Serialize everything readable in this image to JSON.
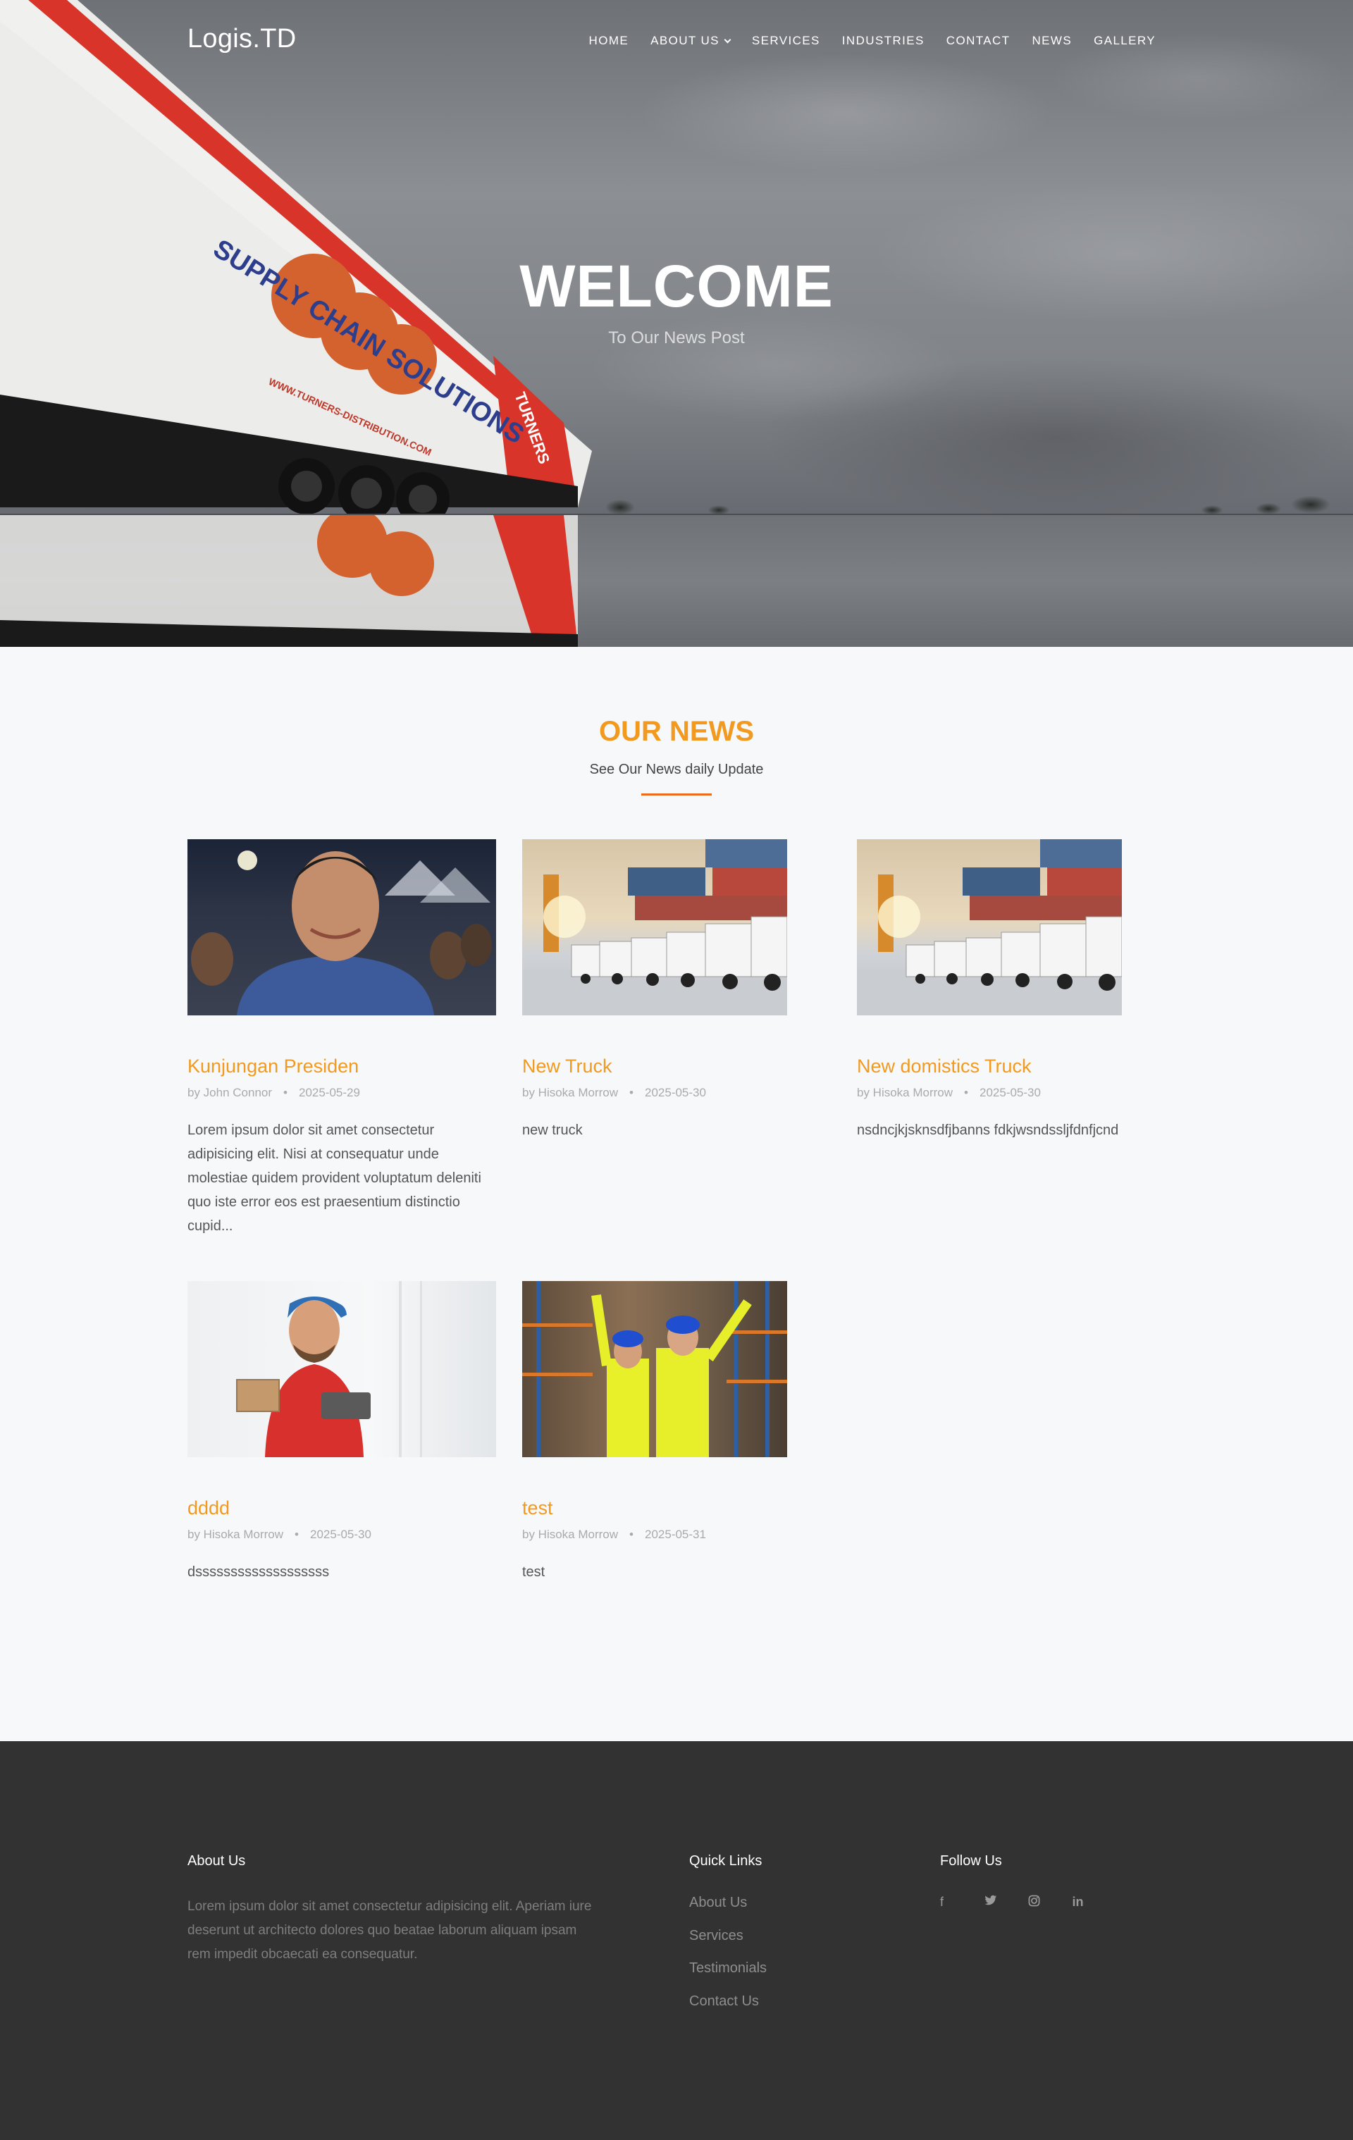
{
  "brand": {
    "logo": "Logis.TD",
    "accent": "#f29a1f",
    "underline": "#ea6a1e",
    "footer_bg": "#323232"
  },
  "nav": {
    "items": [
      {
        "label": "HOME"
      },
      {
        "label": "ABOUT US",
        "has_dropdown": true
      },
      {
        "label": "SERVICES"
      },
      {
        "label": "INDUSTRIES"
      },
      {
        "label": "CONTACT"
      },
      {
        "label": "NEWS"
      },
      {
        "label": "GALLERY"
      }
    ]
  },
  "hero": {
    "title": "WELCOME",
    "subtitle": "To Our News Post",
    "truck_text": "SUPPLY CHAIN SOLUTIONS",
    "truck_url": "WWW.TURNERS-DISTRIBUTION.COM",
    "truck_brand": "TURNERS"
  },
  "news": {
    "title": "OUR NEWS",
    "subtitle": "See Our News daily Update",
    "cards": [
      {
        "title": "Kunjungan Presiden",
        "author": "by John Connor",
        "date": "2025-05-29",
        "excerpt": "Lorem ipsum dolor sit amet consectetur adipisicing elit. Nisi at consequatur unde molestiae quidem provident voluptatum deleniti quo iste error eos est praesentium distinctio cupid...",
        "image": "president-photo"
      },
      {
        "title": "New Truck",
        "author": "by Hisoka Morrow",
        "date": "2025-05-30",
        "excerpt": "new truck",
        "image": "trucks-containers-photo"
      },
      {
        "title": "New domistics Truck",
        "author": "by Hisoka Morrow",
        "date": "2025-05-30",
        "excerpt": "nsdncjkjsknsdfjbanns fdkjwsndssljfdnfjcnd",
        "image": "trucks-containers-photo"
      },
      {
        "title": "dddd",
        "author": "by Hisoka Morrow",
        "date": "2025-05-30",
        "excerpt": "dsssssssssssssssssss",
        "image": "courier-photo"
      },
      {
        "title": "test",
        "author": "by Hisoka Morrow",
        "date": "2025-05-31",
        "excerpt": "test",
        "image": "warehouse-workers-photo"
      }
    ]
  },
  "footer": {
    "about_title": "About Us",
    "about_text": "Lorem ipsum dolor sit amet consectetur adipisicing elit. Aperiam iure deserunt ut architecto dolores quo beatae laborum aliquam ipsam rem impedit obcaecati ea consequatur.",
    "links_title": "Quick Links",
    "links": [
      "About Us",
      "Services",
      "Testimonials",
      "Contact Us"
    ],
    "follow_title": "Follow Us",
    "social": [
      {
        "icon": "facebook-icon",
        "glyph": "f"
      },
      {
        "icon": "twitter-icon",
        "glyph": "🐦"
      },
      {
        "icon": "instagram-icon",
        "glyph": "◎"
      },
      {
        "icon": "linkedin-icon",
        "glyph": "in"
      }
    ]
  }
}
